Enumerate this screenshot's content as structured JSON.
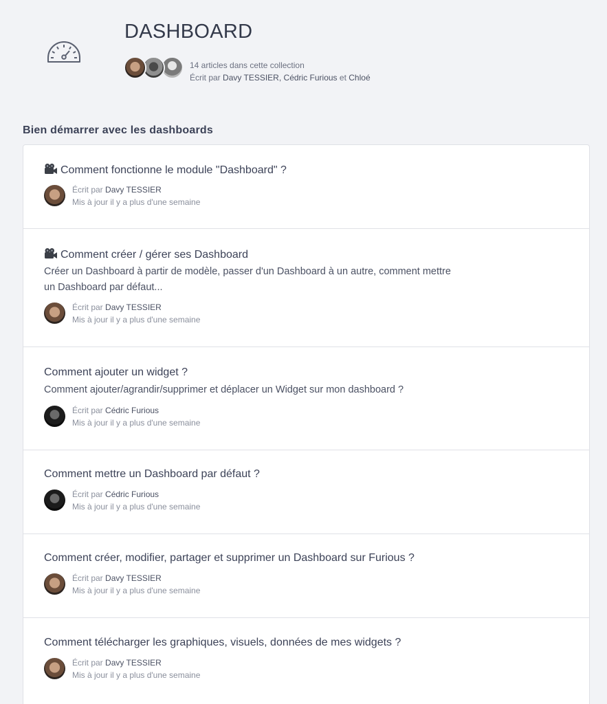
{
  "collection": {
    "title": "DASHBOARD",
    "icon": "speedometer-icon",
    "articles_count": "14 articles dans cette collection",
    "written_by": "Écrit par",
    "authors": [
      "Davy TESSIER",
      "Cédric Furious",
      "Chloé"
    ],
    "separator": ",",
    "and": "et"
  },
  "section": {
    "title": "Bien démarrer avec les dashboards"
  },
  "articles": [
    {
      "title": "Comment fonctionne le module \"Dashboard\" ?",
      "icon": "video-camera-icon",
      "description": "",
      "written_by": "Écrit par",
      "author": "Davy TESSIER",
      "updated": "Mis à jour il y a plus d'une semaine"
    },
    {
      "title": "Comment créer / gérer ses Dashboard",
      "icon": "video-camera-icon",
      "description": "Créer un Dashboard à partir de modèle, passer d'un Dashboard à un autre, comment mettre un Dashboard par défaut...",
      "written_by": "Écrit par",
      "author": "Davy TESSIER",
      "updated": "Mis à jour il y a plus d'une semaine"
    },
    {
      "title": "Comment ajouter un widget ?",
      "description": "Comment ajouter/agrandir/supprimer et déplacer un Widget sur mon dashboard ?",
      "written_by": "Écrit par",
      "author": "Cédric Furious",
      "updated": "Mis à jour il y a plus d'une semaine"
    },
    {
      "title": "Comment mettre un Dashboard par défaut ?",
      "description": "",
      "written_by": "Écrit par",
      "author": "Cédric Furious",
      "updated": "Mis à jour il y a plus d'une semaine"
    },
    {
      "title": "Comment créer, modifier, partager et supprimer un Dashboard sur Furious ?",
      "description": "",
      "written_by": "Écrit par",
      "author": "Davy TESSIER",
      "updated": "Mis à jour il y a plus d'une semaine"
    },
    {
      "title": "Comment télécharger les graphiques, visuels, données de mes widgets ?",
      "description": "",
      "written_by": "Écrit par",
      "author": "Davy TESSIER",
      "updated": "Mis à jour il y a plus d'une semaine"
    }
  ]
}
